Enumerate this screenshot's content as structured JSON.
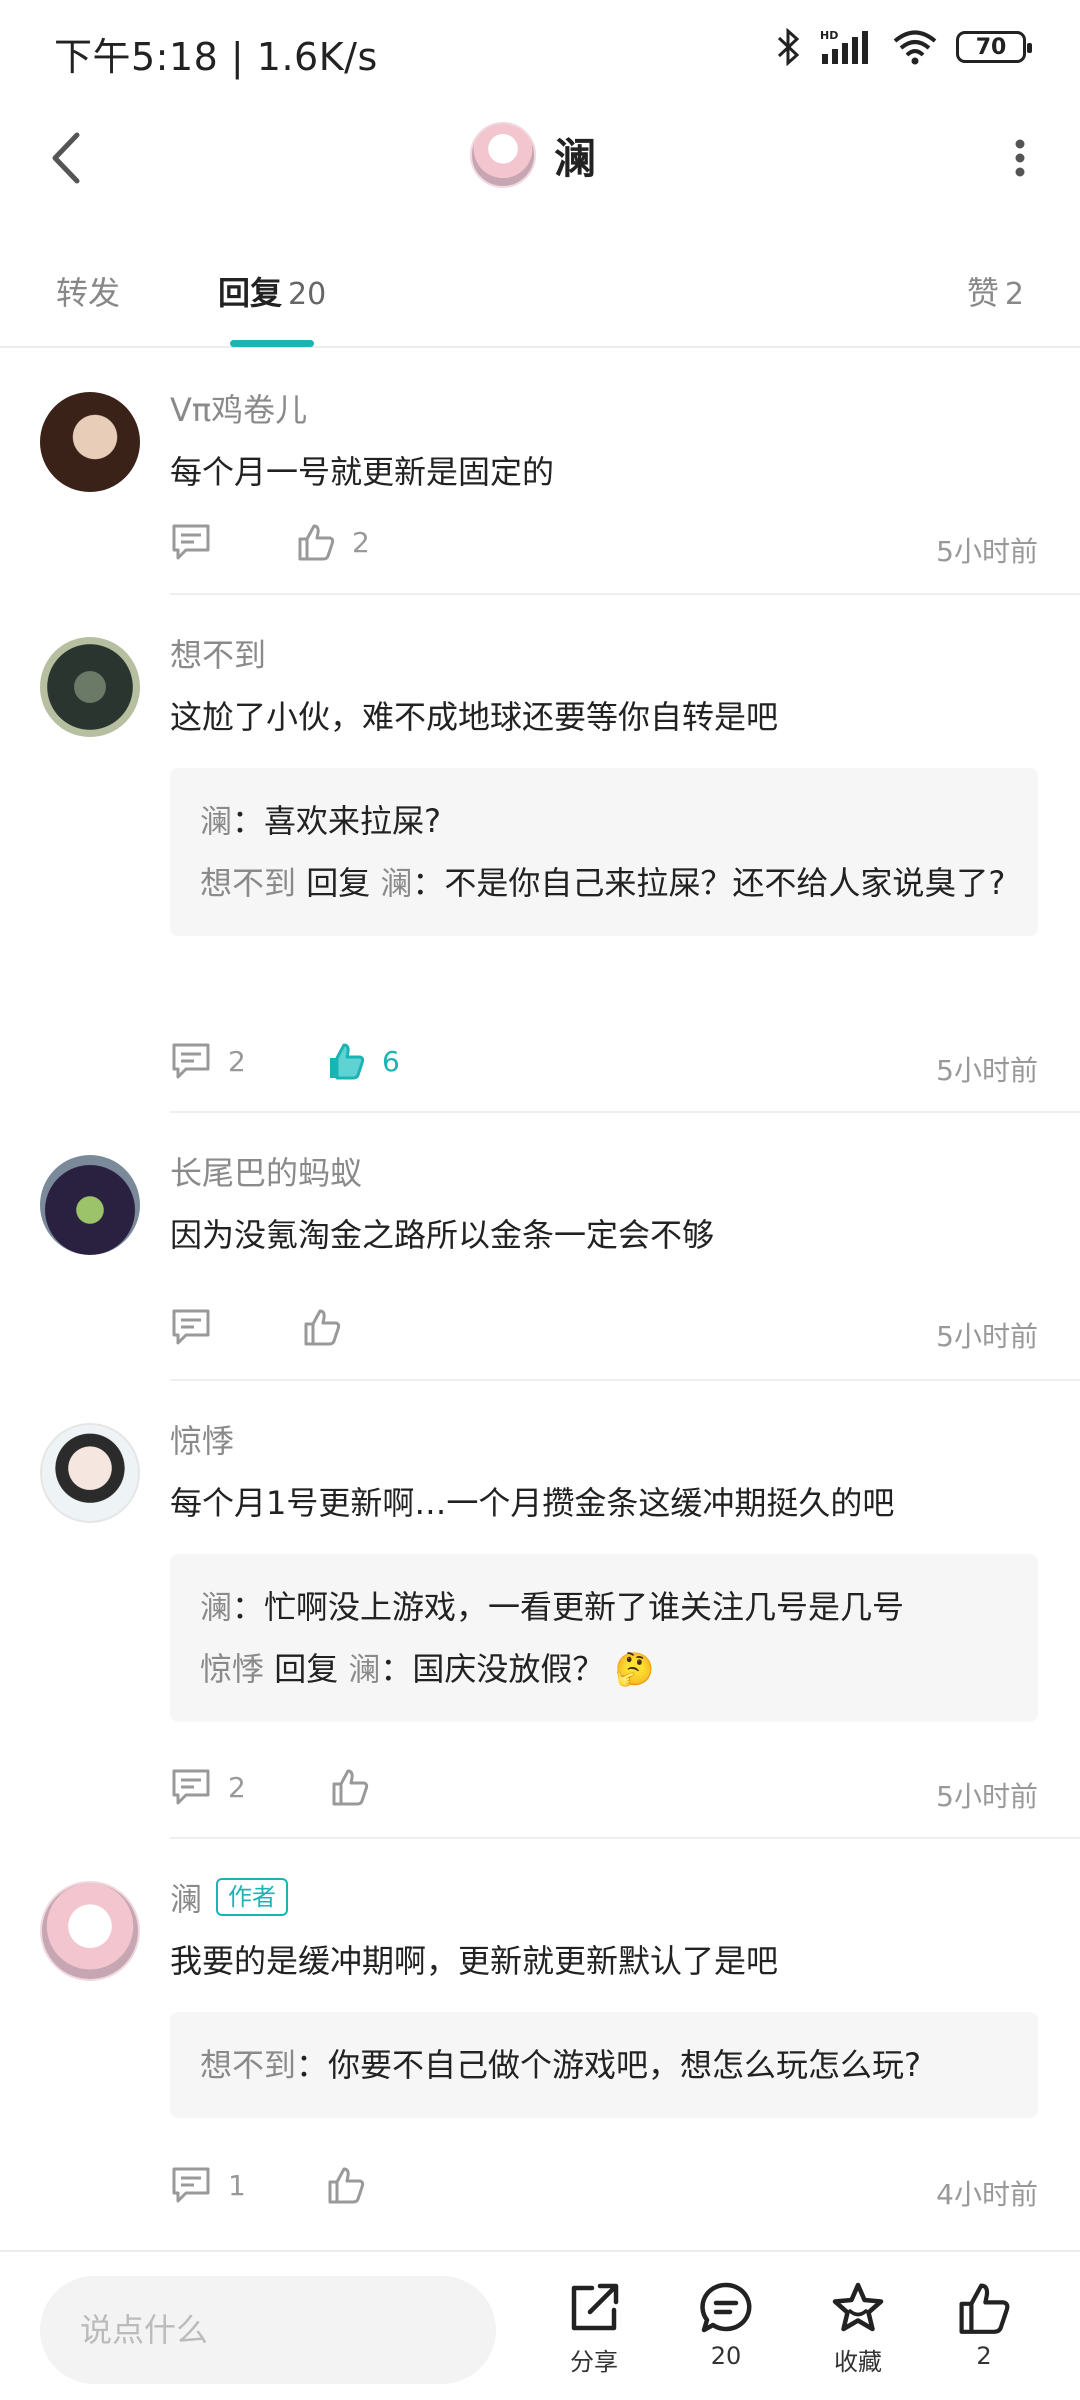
{
  "status_bar": {
    "time_speed": "下午5:18 | 1.6K/s",
    "battery": "70",
    "hd_label": "HD"
  },
  "header": {
    "title": "澜"
  },
  "tabs": {
    "forward": "转发",
    "reply": "回复",
    "reply_count": "20",
    "like": "赞",
    "like_count": "2"
  },
  "comments": [
    {
      "name": "Vπ鸡卷儿",
      "text": "每个月一号就更新是固定的",
      "reply_count": "",
      "like_count": "2",
      "liked": false,
      "time": "5小时前"
    },
    {
      "name": "想不到",
      "text": "这尬了小伙，难不成地球还要等你自转是吧",
      "replies": [
        {
          "from": "澜",
          "text": "：喜欢来拉屎?"
        },
        {
          "from": "想不到",
          "verb": "回复",
          "to": "澜",
          "text": "：不是你自己来拉屎？还不给人家说臭了?"
        }
      ],
      "reply_count": "2",
      "like_count": "6",
      "liked": true,
      "time": "5小时前"
    },
    {
      "name": "长尾巴的蚂蚁",
      "text": "因为没氪淘金之路所以金条一定会不够",
      "reply_count": "",
      "like_count": "",
      "liked": false,
      "time": "5小时前"
    },
    {
      "name": "惊悸",
      "text": "每个月1号更新啊…一个月攒金条这缓冲期挺久的吧",
      "replies": [
        {
          "from": "澜",
          "text": "：忙啊没上游戏，一看更新了谁关注几号是几号"
        },
        {
          "from": "惊悸",
          "verb": "回复",
          "to": "澜",
          "text": "：国庆没放假？",
          "emoji": "🤔"
        }
      ],
      "reply_count": "2",
      "like_count": "",
      "liked": false,
      "time": "5小时前"
    },
    {
      "name": "澜",
      "badge": "作者",
      "text": "我要的是缓冲期啊，更新就更新默认了是吧",
      "replies": [
        {
          "from": "想不到",
          "text": "：你要不自己做个游戏吧，想怎么玩怎么玩?"
        }
      ],
      "reply_count": "1",
      "like_count": "",
      "liked": false,
      "time": "4小时前"
    }
  ],
  "bottom_bar": {
    "input_placeholder": "说点什么",
    "share_label": "分享",
    "comment_count": "20",
    "favorite_label": "收藏",
    "like_count": "2"
  },
  "colors": {
    "accent": "#1bb4b4",
    "text_primary": "#222222",
    "text_secondary": "#8a8a8a"
  }
}
